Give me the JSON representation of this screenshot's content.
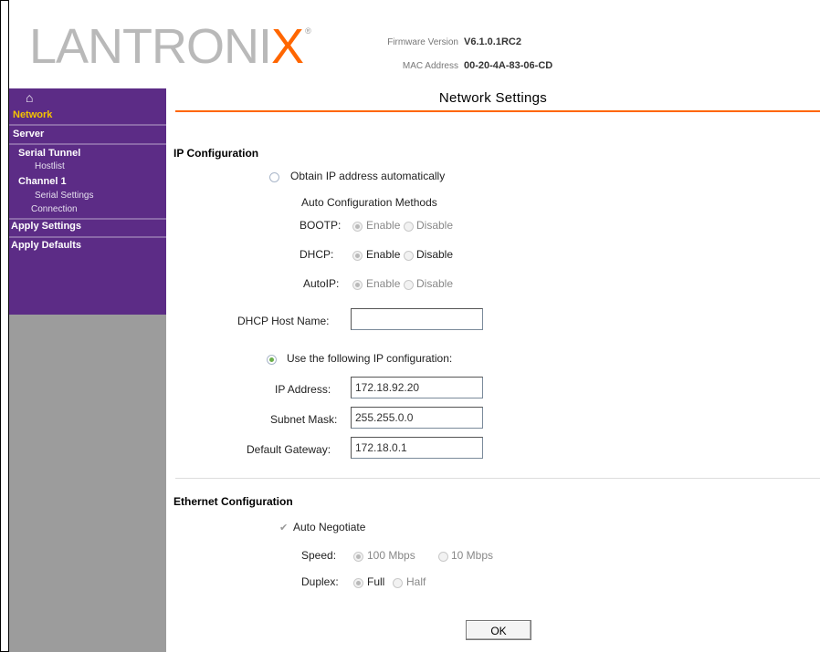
{
  "header": {
    "logo_text": "LANTRONIX",
    "firmware_label": "Firmware Version",
    "firmware_value": "V6.1.0.1RC2",
    "mac_label": "MAC Address",
    "mac_value": "00-20-4A-83-06-CD"
  },
  "sidebar": {
    "home_icon": "home-icon",
    "items": {
      "network": "Network",
      "server": "Server",
      "serial_tunnel": "Serial Tunnel",
      "hostlist": "Hostlist",
      "channel1": "Channel 1",
      "serial_settings": "Serial Settings",
      "connection": "Connection",
      "apply_settings": "Apply Settings",
      "apply_defaults": "Apply Defaults"
    }
  },
  "main": {
    "title": "Network Settings",
    "ip_config": {
      "section_title": "IP Configuration",
      "obtain_auto_label": "Obtain IP address automatically",
      "auto_defaults_label": "Auto Configuration Methods",
      "bootp_label": "BOOTP:",
      "dhcp_label": "DHCP:",
      "autoip_label": "AutoIP:",
      "enable_label": "Enable",
      "disable_label": "Disable",
      "dhcp_hostname_label": "DHCP Host Name:",
      "dhcp_hostname_value": "",
      "use_static_label": "Use the following IP configuration:",
      "ip_address_label": "IP Address:",
      "ip_address_value": "172.18.92.20",
      "subnet_mask_label": "Subnet Mask:",
      "subnet_mask_value": "255.255.0.0",
      "gateway_label": "Default Gateway:",
      "gateway_value": "172.18.0.1"
    },
    "ethernet_config": {
      "section_title": "Ethernet Configuration",
      "auto_negotiate_label": "Auto Negotiate",
      "speed_label": "Speed:",
      "speed_100_label": "100 Mbps",
      "speed_10_label": "10 Mbps",
      "duplex_label": "Duplex:",
      "full_label": "Full",
      "half_label": "Half"
    },
    "ok_label": "OK"
  }
}
